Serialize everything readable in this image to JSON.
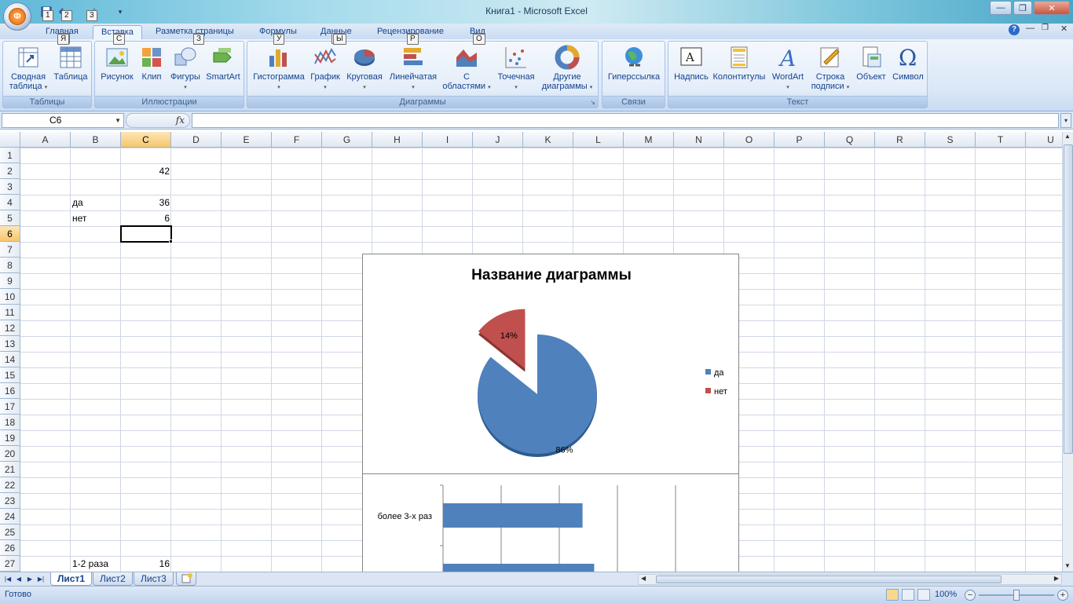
{
  "window": {
    "title": "Книга1 - Microsoft Excel",
    "office_keytip": "Ф",
    "qat_keytips": [
      "1",
      "2",
      "3"
    ]
  },
  "tabs": [
    {
      "label": "Главная",
      "keytip": "Я",
      "active": false
    },
    {
      "label": "Вставка",
      "keytip": "С",
      "active": true
    },
    {
      "label": "Разметка страницы",
      "keytip": "З",
      "active": false
    },
    {
      "label": "Формулы",
      "keytip": "У",
      "active": false
    },
    {
      "label": "Данные",
      "keytip": "Ы",
      "active": false
    },
    {
      "label": "Рецензирование",
      "keytip": "Р",
      "active": false
    },
    {
      "label": "Вид",
      "keytip": "О",
      "active": false
    }
  ],
  "ribbon": {
    "groups": {
      "tables": "Таблицы",
      "illustrations": "Иллюстрации",
      "charts": "Диаграммы",
      "links": "Связи",
      "text": "Текст"
    },
    "buttons": {
      "pivot_1": "Сводная",
      "pivot_2": "таблица",
      "table": "Таблица",
      "picture": "Рисунок",
      "clip": "Клип",
      "shapes": "Фигуры",
      "smartart": "SmartArt",
      "histogram": "Гистограмма",
      "line": "График",
      "pie": "Круговая",
      "bar": "Линейчатая",
      "area_1": "С",
      "area_2": "областями",
      "scatter": "Точечная",
      "other_1": "Другие",
      "other_2": "диаграммы",
      "hyperlink": "Гиперссылка",
      "textbox": "Надпись",
      "headerfooter": "Колонтитулы",
      "wordart": "WordArt",
      "signature_1": "Строка",
      "signature_2": "подписи",
      "object": "Объект",
      "symbol": "Символ"
    }
  },
  "formula_bar": {
    "name_box": "C6",
    "fx": "fx",
    "formula": ""
  },
  "columns": [
    "A",
    "B",
    "C",
    "D",
    "E",
    "F",
    "G",
    "H",
    "I",
    "J",
    "K",
    "L",
    "M",
    "N",
    "O",
    "P",
    "Q",
    "R",
    "S",
    "T",
    "U"
  ],
  "selected_column": "C",
  "rows": [
    "1",
    "2",
    "3",
    "4",
    "5",
    "6",
    "7",
    "8",
    "9",
    "10",
    "11",
    "12",
    "13",
    "14",
    "15",
    "16",
    "17",
    "18",
    "19",
    "20",
    "21",
    "22",
    "23",
    "24",
    "25",
    "26",
    "27"
  ],
  "selected_row": "6",
  "cells": [
    {
      "col": "C",
      "row": 2,
      "value": "42",
      "num": true
    },
    {
      "col": "B",
      "row": 4,
      "value": "да",
      "num": false
    },
    {
      "col": "C",
      "row": 4,
      "value": "36",
      "num": true
    },
    {
      "col": "B",
      "row": 5,
      "value": "нет",
      "num": false
    },
    {
      "col": "C",
      "row": 5,
      "value": "6",
      "num": true
    },
    {
      "col": "B",
      "row": 27,
      "value": "1-2 раза",
      "num": false
    },
    {
      "col": "C",
      "row": 27,
      "value": "16",
      "num": true
    }
  ],
  "chart_data": [
    {
      "type": "pie",
      "title": "Название диаграммы",
      "categories": [
        "да",
        "нет"
      ],
      "values": [
        36,
        6
      ],
      "percent_labels": [
        "86%",
        "14%"
      ],
      "colors": [
        "#4f81bd",
        "#c0504d"
      ],
      "exploded": [
        "нет"
      ],
      "legend": "right"
    },
    {
      "type": "bar",
      "orientation": "horizontal",
      "categories": [
        "более 3-х раз"
      ],
      "series": [
        {
          "values": [
            24
          ]
        }
      ],
      "color": "#4f81bd",
      "xlim": [
        0,
        40
      ],
      "grid": true
    }
  ],
  "sheets": [
    {
      "label": "Лист1",
      "active": true
    },
    {
      "label": "Лист2",
      "active": false
    },
    {
      "label": "Лист3",
      "active": false
    }
  ],
  "status": {
    "text": "Готово",
    "zoom": "100%"
  }
}
